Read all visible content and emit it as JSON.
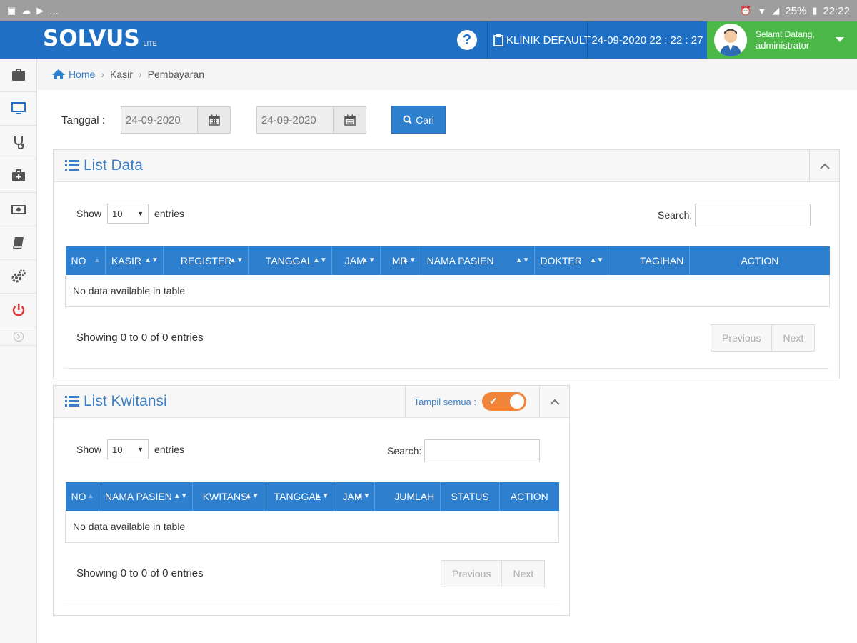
{
  "status_bar": {
    "icons_left": "...",
    "battery": "25%",
    "time": "22:22"
  },
  "header": {
    "logo": "SOLVUS",
    "logo_suffix": "LITE",
    "help_label": "?",
    "clinic": "KLINIK DEFAULT",
    "datetime": "24-09-2020 22 : 22 : 27",
    "greeting": "Selamt Datang,",
    "username": "administrator",
    "accent_color": "#1f6fc5",
    "user_color": "#4cb848"
  },
  "sidebar": {
    "items": [
      "briefcase-icon",
      "monitor-icon",
      "stethoscope-icon",
      "medkit-icon",
      "money-icon",
      "book-icon",
      "cogs-icon",
      "power-icon",
      "expand-icon"
    ]
  },
  "breadcrumb": {
    "home": "Home",
    "items": [
      "Kasir",
      "Pembayaran"
    ]
  },
  "filter": {
    "label": "Tanggal :",
    "date_from": "24-09-2020",
    "date_to": "24-09-2020",
    "search_button": "Cari"
  },
  "list_data": {
    "title": "List Data",
    "show_label": "Show",
    "entries_value": "10",
    "entries_label": "entries",
    "search_label": "Search:",
    "columns": [
      "NO",
      "KASIR",
      "REGISTER",
      "TANGGAL",
      "JAM",
      "MR",
      "NAMA PASIEN",
      "DOKTER",
      "TAGIHAN",
      "ACTION"
    ],
    "empty_text": "No data available in table",
    "showing": "Showing 0 to 0 of 0 entries",
    "prev": "Previous",
    "next": "Next"
  },
  "list_kwitansi": {
    "title": "List Kwitansi",
    "tampil_label": "Tampil semua :",
    "show_label": "Show",
    "entries_value": "10",
    "entries_label": "entries",
    "search_label": "Search:",
    "columns": [
      "NO",
      "NAMA PASIEN",
      "KWITANSI",
      "TANGGAL",
      "JAM",
      "JUMLAH",
      "STATUS",
      "ACTION"
    ],
    "empty_text": "No data available in table",
    "showing": "Showing 0 to 0 of 0 entries",
    "prev": "Previous",
    "next": "Next"
  }
}
